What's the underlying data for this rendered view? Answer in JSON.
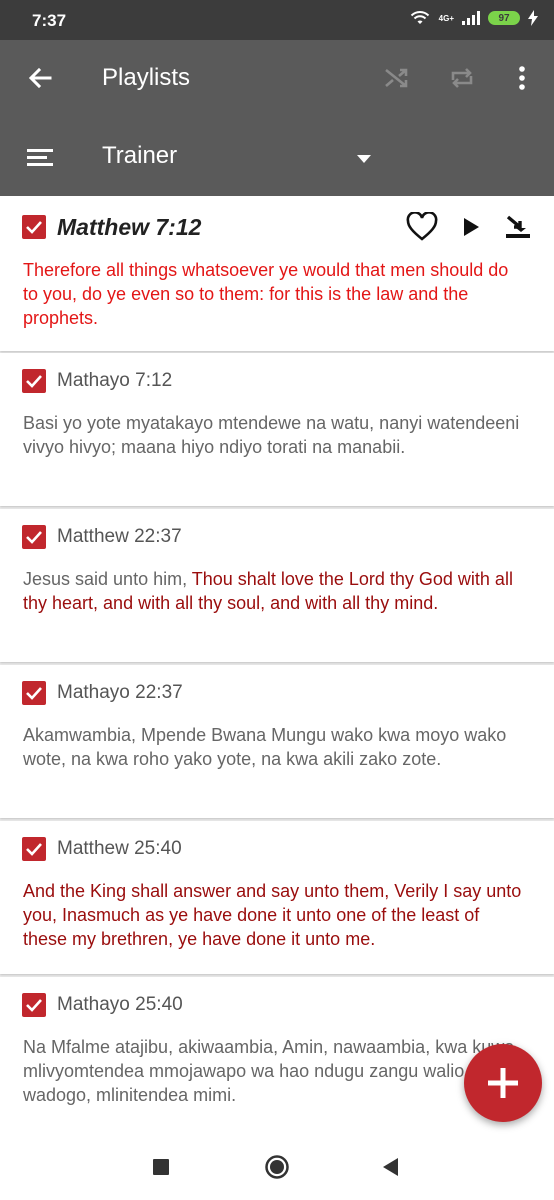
{
  "status_bar": {
    "time": "7:37",
    "network": "4G+",
    "battery": "97"
  },
  "toolbar": {
    "title": "Playlists",
    "playlist": "Trainer"
  },
  "items": [
    {
      "reference": "Matthew 7:12",
      "text_plain": "",
      "text_colored": "Therefore all things whatsoever ye would that men should do to you, do ye even so to them: for this is the law and the prophets."
    },
    {
      "reference": "Mathayo 7:12",
      "text_plain": "Basi yo yote myatakayo mtendewe na watu, nanyi watendeeni vivyo hivyo; maana hiyo ndiyo torati na manabii.",
      "text_colored": ""
    },
    {
      "reference": "Matthew 22:37",
      "text_plain": "Jesus said unto him, ",
      "text_colored": "Thou shalt love the Lord thy God with all thy heart, and with all thy soul, and with all thy mind."
    },
    {
      "reference": "Mathayo 22:37",
      "text_plain": "Akamwambia, Mpende Bwana Mungu wako kwa moyo wako wote, na kwa roho yako yote, na kwa akili zako zote.",
      "text_colored": ""
    },
    {
      "reference": "Matthew 25:40",
      "text_plain": "",
      "text_colored": "And the King shall answer and say unto them, Verily I say unto you, Inasmuch as ye have done it unto one of the least of these my brethren, ye have done it unto me."
    },
    {
      "reference": "Mathayo 25:40",
      "text_plain": "Na Mfalme atajibu, akiwaambia, Amin, nawaambia, kwa kuwa mlivyomtendea mmojawapo wa hao ndugu zangu walio wadogo, mlinitendea mimi.",
      "text_colored": ""
    }
  ],
  "colors": {
    "accent": "#c1272d",
    "toolbar": "#5a5a5a",
    "verse_red": "#e31616",
    "verse_dark_red": "#9a0d0d"
  }
}
